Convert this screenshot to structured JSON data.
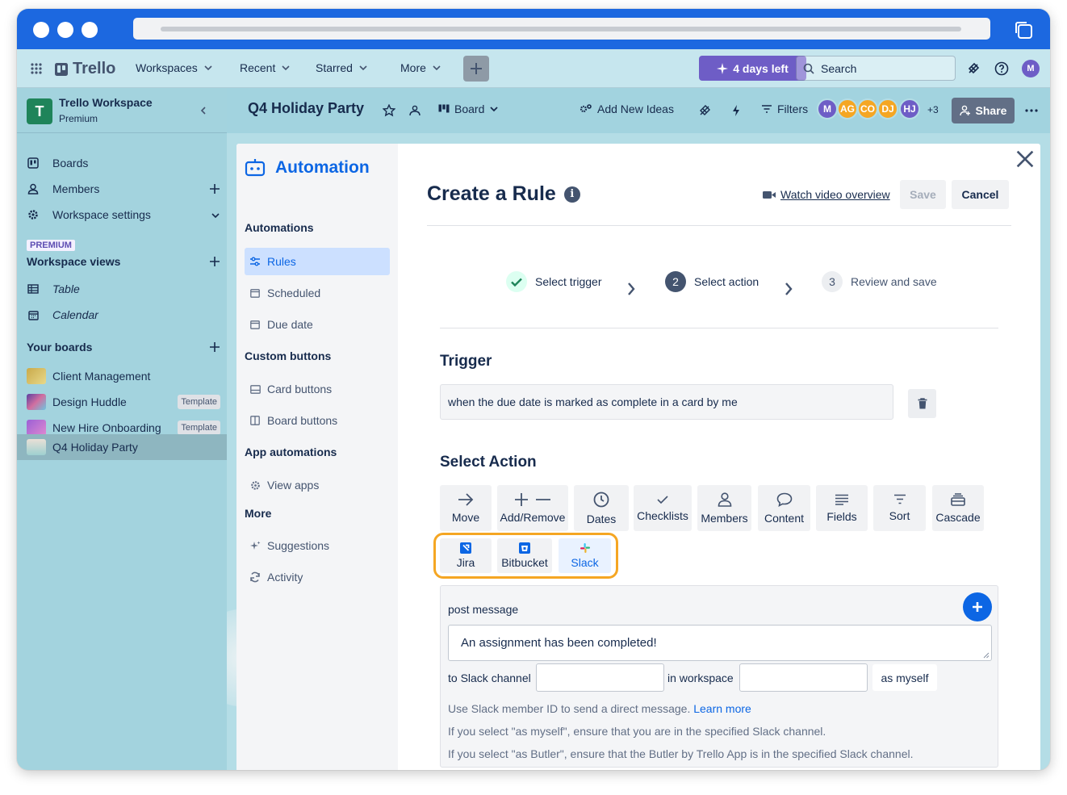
{
  "topnav": {
    "logo": "Trello",
    "items": [
      "Workspaces",
      "Recent",
      "Starred",
      "More"
    ],
    "trial_label": "4 days left",
    "search_placeholder": "Search",
    "user_initial": "M"
  },
  "sidebar": {
    "workspace_name": "Trello Workspace",
    "workspace_plan": "Premium",
    "workspace_initial": "T",
    "nav": [
      "Boards",
      "Members",
      "Workspace settings"
    ],
    "premium_badge": "PREMIUM",
    "views_heading": "Workspace views",
    "views": [
      "Table",
      "Calendar"
    ],
    "boards_heading": "Your boards",
    "boards": [
      {
        "name": "Client Management",
        "badge": "",
        "color": "#d8c15a"
      },
      {
        "name": "Design Huddle",
        "badge": "Template",
        "color": "#8a5fc4"
      },
      {
        "name": "New Hire Onboarding",
        "badge": "Template",
        "color": "#b66fd8"
      },
      {
        "name": "Q4 Holiday Party",
        "badge": "",
        "color": "#c4d7d0"
      }
    ]
  },
  "boardbar": {
    "title": "Q4 Holiday Party",
    "view": "Board",
    "add_ideas": "Add New Ideas",
    "filters": "Filters",
    "avatars": [
      {
        "initials": "M",
        "color": "#6e5dc6"
      },
      {
        "initials": "AG",
        "color": "#f5a623"
      },
      {
        "initials": "CO",
        "color": "#f5a623"
      },
      {
        "initials": "DJ",
        "color": "#f5a623"
      },
      {
        "initials": "HJ",
        "color": "#6e5dc6"
      }
    ],
    "more_members": "+3",
    "share": "Share"
  },
  "automation": {
    "title": "Automation",
    "sections": [
      {
        "heading": "Automations",
        "items": [
          "Rules",
          "Scheduled",
          "Due date"
        ]
      },
      {
        "heading": "Custom buttons",
        "items": [
          "Card buttons",
          "Board buttons"
        ]
      },
      {
        "heading": "App automations",
        "items": [
          "View apps"
        ]
      },
      {
        "heading": "More",
        "items": [
          "Suggestions",
          "Activity"
        ]
      }
    ]
  },
  "rule": {
    "title": "Create a Rule",
    "watch_video": "Watch video overview",
    "save": "Save",
    "cancel": "Cancel",
    "steps": [
      {
        "number": "",
        "label": "Select trigger",
        "state": "done"
      },
      {
        "number": "2",
        "label": "Select action",
        "state": "current"
      },
      {
        "number": "3",
        "label": "Review and save",
        "state": "upcoming"
      }
    ],
    "trigger_heading": "Trigger",
    "trigger_text": "when the due date is marked as complete in a card by me",
    "action_heading": "Select Action",
    "actions": [
      "Move",
      "Add/Remove",
      "Dates",
      "Checklists",
      "Members",
      "Content",
      "Fields",
      "Sort",
      "Cascade"
    ],
    "integrations": [
      "Jira",
      "Bitbucket",
      "Slack"
    ],
    "selected_integration": "Slack",
    "post_message_label": "post message",
    "message": "An assignment has been completed!",
    "to_channel_label": "to Slack channel",
    "channel_value": "",
    "in_workspace_label": "in workspace",
    "workspace_value": "",
    "as_label": "as myself",
    "note_1": "Use Slack member ID to send a direct message.",
    "learn_more": "Learn more",
    "note_2": "If you select \"as myself\", ensure that you are in the specified Slack channel.",
    "note_3": "If you select \"as Butler\", ensure that the Butler by Trello App is in the specified Slack channel."
  },
  "colors": {
    "accent": "#0c66e4",
    "highlight": "#f5a623",
    "browser_bar": "#1c68e0"
  }
}
